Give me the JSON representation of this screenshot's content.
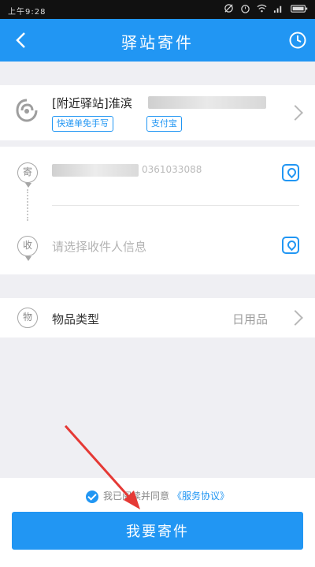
{
  "status_bar": {
    "time": "上午9:28"
  },
  "header": {
    "title": "驿站寄件"
  },
  "station": {
    "name": "[附近驿站]淮滨",
    "tags": [
      "快递单免手写",
      "支付宝"
    ]
  },
  "sender": {
    "icon_label": "寄",
    "phone": "0361033088"
  },
  "receiver": {
    "icon_label": "收",
    "placeholder": "请选择收件人信息"
  },
  "goods": {
    "icon_label": "物",
    "label": "物品类型",
    "value": "日用品"
  },
  "footer": {
    "agree_text": "我已阅读并同意",
    "agreement_link": "《服务协议》",
    "submit_label": "我要寄件"
  },
  "colors": {
    "accent": "#2196f3",
    "annotation_arrow": "#e53935"
  }
}
